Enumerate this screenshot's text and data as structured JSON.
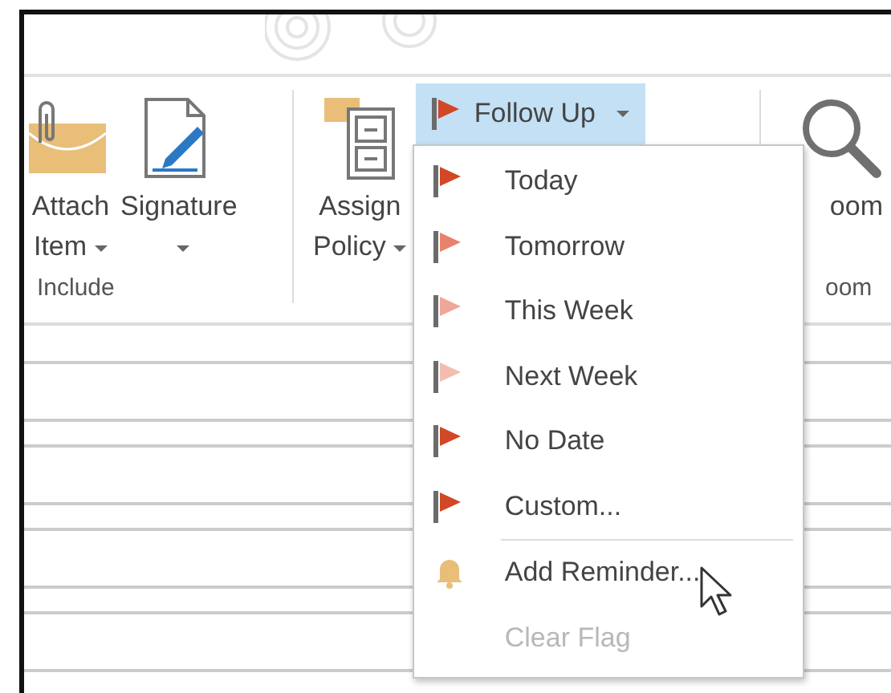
{
  "ribbon": {
    "groups": [
      {
        "label": "Include",
        "buttons": [
          {
            "kind": "attach",
            "label_lines": [
              "Attach",
              "Item"
            ],
            "dropdown": true
          },
          {
            "kind": "signature",
            "label_lines": [
              "Signature"
            ],
            "dropdown": true
          }
        ]
      },
      {
        "buttons": [
          {
            "kind": "policy",
            "label_lines": [
              "Assign",
              "Policy"
            ],
            "dropdown": true
          }
        ],
        "follow_up": {
          "label": "Follow Up",
          "dropdown": true,
          "open": true,
          "menu": [
            {
              "kind": "flag",
              "label": "Today",
              "color": "#d24726",
              "disabled": false
            },
            {
              "kind": "flag",
              "label": "Tomorrow",
              "color": "#e8836b",
              "disabled": false
            },
            {
              "kind": "flag",
              "label": "This Week",
              "color": "#efa797",
              "disabled": false
            },
            {
              "kind": "flag",
              "label": "Next Week",
              "color": "#f3bdb1",
              "disabled": false
            },
            {
              "kind": "flag",
              "label": "No Date",
              "color": "#d24726",
              "disabled": false
            },
            {
              "kind": "flag",
              "label": "Custom...",
              "color": "#d24726",
              "disabled": false
            },
            {
              "kind": "separator"
            },
            {
              "kind": "bell",
              "label": "Add Reminder...",
              "disabled": false
            },
            {
              "kind": "none",
              "label": "Clear Flag",
              "disabled": true
            }
          ]
        }
      },
      {
        "label": "oom",
        "buttons": [
          {
            "kind": "zoom",
            "label_lines": [
              "oom"
            ],
            "dropdown": false
          }
        ]
      }
    ]
  }
}
